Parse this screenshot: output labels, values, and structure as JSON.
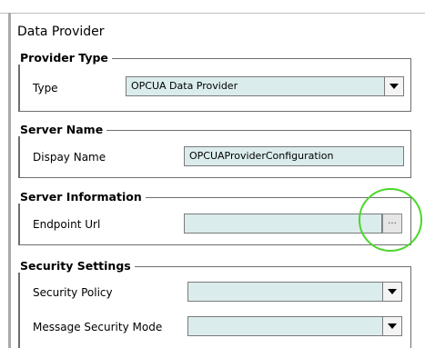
{
  "panel": {
    "title": "Data Provider"
  },
  "provider_type": {
    "legend": "Provider Type",
    "type_label": "Type",
    "type_value": "OPCUA Data Provider"
  },
  "server_name": {
    "legend": "Server Name",
    "display_name_label": "Dispay Name",
    "display_name_value": "OPCUAProviderConfiguration"
  },
  "server_information": {
    "legend": "Server Information",
    "endpoint_label": "Endpoint Url",
    "endpoint_value": "",
    "browse_label": "..."
  },
  "security_settings": {
    "legend": "Security Settings",
    "policy_label": "Security Policy",
    "policy_value": "",
    "mode_label": "Message Security Mode",
    "mode_value": ""
  },
  "colors": {
    "field_bg": "#dbecec",
    "highlight": "#4bd62a"
  }
}
